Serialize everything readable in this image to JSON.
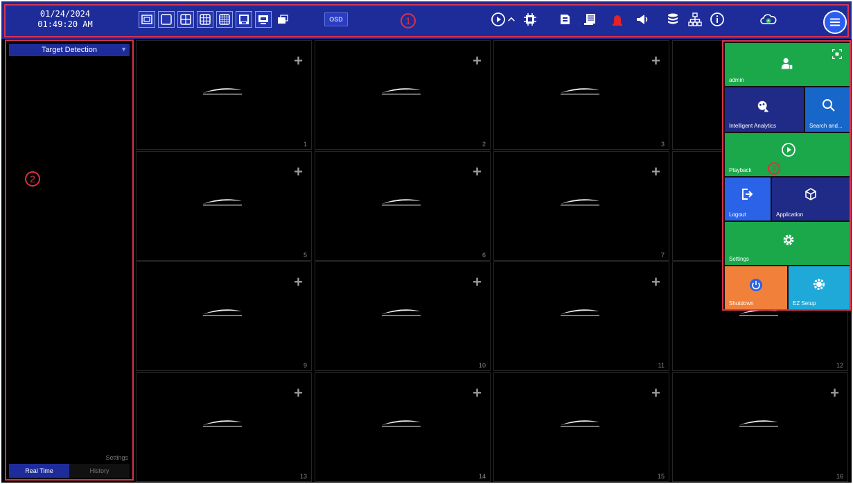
{
  "topbar": {
    "date": "01/24/2024",
    "time": "01:49:20 AM",
    "callout": "1",
    "osd_label": "OSD",
    "layout_buttons": [
      "single-view-icon",
      "one-split-icon",
      "four-split-icon",
      "nine-split-icon",
      "sixteen-split-icon",
      "display-icon",
      "window-icon"
    ],
    "right_icons": [
      "playback-icon",
      "chevron-up-icon",
      "chip-icon",
      "disk-icon",
      "log-icon",
      "alarm-icon",
      "speaker-icon",
      "database-icon",
      "network-icon",
      "info-icon",
      "cloud-icon"
    ]
  },
  "left_panel": {
    "callout": "2",
    "title": "Target Detection",
    "settings_label": "Settings",
    "tabs": [
      {
        "label": "Real Time"
      },
      {
        "label": "History"
      }
    ]
  },
  "grid": {
    "logo_text": "speco technologies",
    "channel_numbers": [
      "1",
      "2",
      "3",
      "",
      "5",
      "6",
      "7",
      "",
      "9",
      "10",
      "11",
      "12",
      "13",
      "14",
      "15",
      "16"
    ]
  },
  "right_menu": {
    "callout": "3",
    "user": "admin",
    "tiles": {
      "intelligent_analytics": "Intelligent Analytics",
      "search": "Search and...",
      "playback": "Playback",
      "logout": "Logout",
      "application": "Application",
      "settings": "Settings",
      "shutdown": "Shutdown",
      "ez_setup": "EZ Setup"
    }
  },
  "colors": {
    "toolbar_bg": "#1e2c9a",
    "highlight_red": "#d8334a",
    "tile_green": "#1aa84a",
    "tile_navy": "#1f2b86",
    "tile_blue": "#1766c9",
    "tile_orange": "#f0803a",
    "tile_cyan": "#1ea9d8"
  }
}
